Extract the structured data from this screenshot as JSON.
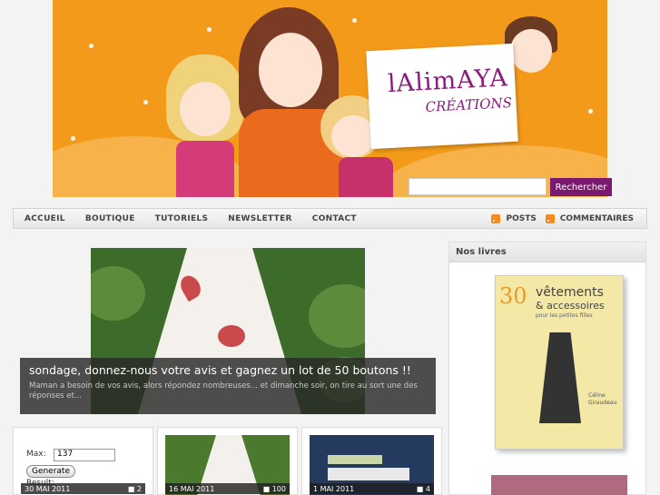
{
  "header": {
    "logo_main": "lAlimAYA",
    "logo_sub": "CRÉATIONS",
    "search_button": "Rechercher",
    "search_placeholder": ""
  },
  "nav": {
    "items": [
      {
        "label": "ACCUEIL"
      },
      {
        "label": "BOUTIQUE"
      },
      {
        "label": "TUTORIELS"
      },
      {
        "label": "NEWSLETTER"
      },
      {
        "label": "CONTACT"
      }
    ],
    "feeds": [
      {
        "label": "POSTS",
        "icon": "rss-icon"
      },
      {
        "label": "COMMENTAIRES",
        "icon": "rss-icon"
      }
    ]
  },
  "featured": {
    "title": "sondage, donnez-nous votre avis et gagnez un lot de 50 boutons !!",
    "excerpt": "Maman a besoin de vos avis, alors répondez nombreuses... et dimanche soir, on tire au sort une des réponses et..."
  },
  "thumbs": [
    {
      "date": "30 MAI 2011",
      "comments": "2",
      "form": {
        "max_label": "Max:",
        "max_value": "137",
        "button": "Generate",
        "result_label": "Result:"
      }
    },
    {
      "date": "16 MAI 2011",
      "comments": "100"
    },
    {
      "date": "1 MAI 2011",
      "comments": "4"
    }
  ],
  "sidebar": {
    "heading": "Nos livres",
    "book": {
      "number": "30",
      "title_line1": "vêtements",
      "title_line2": "& accessoires",
      "title_line3": "pour les petites filles",
      "author": "Céline\nGiraudeau"
    }
  },
  "colors": {
    "banner_orange": "#f39a1a",
    "accent_purple": "#7a1a6e",
    "rss_orange": "#f28c1a"
  }
}
